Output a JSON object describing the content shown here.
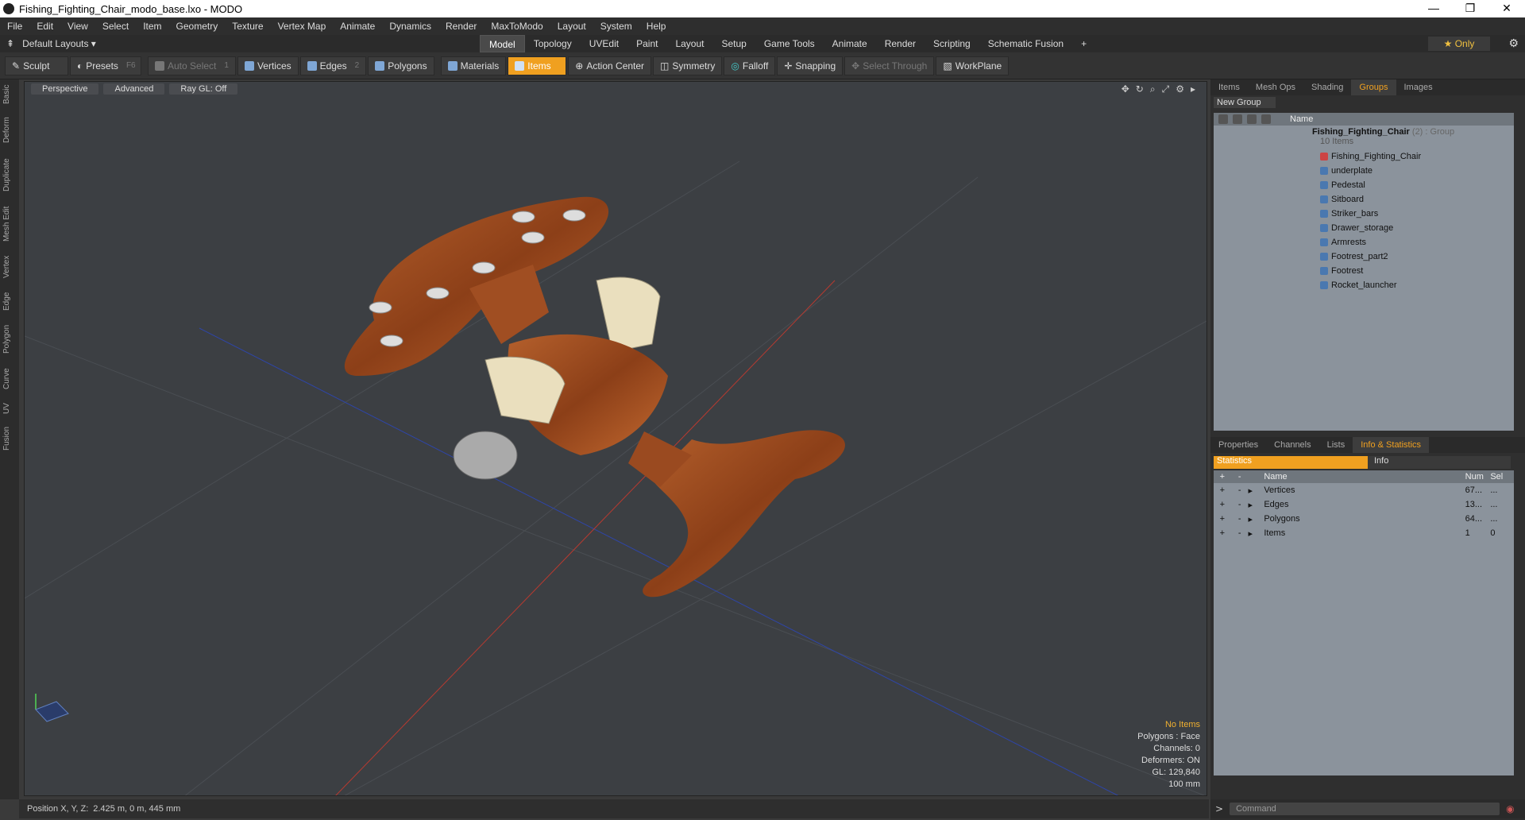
{
  "window": {
    "title": "Fishing_Fighting_Chair_modo_base.lxo - MODO",
    "controls": [
      "—",
      "❐",
      "✕"
    ]
  },
  "menu": [
    "File",
    "Edit",
    "View",
    "Select",
    "Item",
    "Geometry",
    "Texture",
    "Vertex Map",
    "Animate",
    "Dynamics",
    "Render",
    "MaxToModo",
    "Layout",
    "System",
    "Help"
  ],
  "layout": {
    "default": "Default Layouts ▾",
    "tabs": [
      "Model",
      "Topology",
      "UVEdit",
      "Paint",
      "Layout",
      "Setup",
      "Game Tools",
      "Animate",
      "Render",
      "Scripting",
      "Schematic Fusion"
    ],
    "active_tab": "Model",
    "plus": "+",
    "only": "★ Only"
  },
  "toolbar": {
    "sculpt": "Sculpt",
    "presets": "Presets",
    "presets_key": "F6",
    "auto_select": "Auto Select",
    "vertices": "Vertices",
    "vertices_count": "1",
    "edges": "Edges",
    "edges_count": "2",
    "polygons": "Polygons",
    "materials": "Materials",
    "items": "Items",
    "action_center": "Action Center",
    "symmetry": "Symmetry",
    "falloff": "Falloff",
    "snapping": "Snapping",
    "select_through": "Select Through",
    "workplane": "WorkPlane"
  },
  "left_tabs": [
    "Basic",
    "Deform",
    "Duplicate",
    "Mesh Edit",
    "Vertex",
    "Edge",
    "Polygon",
    "Curve",
    "UV",
    "Fusion"
  ],
  "viewport": {
    "view": "Perspective",
    "shading": "Advanced",
    "raygl": "Ray GL: Off",
    "stats": {
      "selection": "No Items",
      "polygons": "Polygons : Face",
      "channels": "Channels: 0",
      "deformers": "Deformers: ON",
      "gl": "GL: 129,840",
      "scale": "100 mm"
    }
  },
  "status": {
    "label": "Position X, Y, Z:",
    "value": "2.425 m, 0 m, 445 mm"
  },
  "items_panel": {
    "tabs": [
      "Items",
      "Mesh Ops",
      "Shading",
      "Groups",
      "Images"
    ],
    "active_tab": "Groups",
    "new_group": "New Group",
    "name_header": "Name",
    "group_name": "Fishing_Fighting_Chair",
    "group_count": "(2)",
    "group_type": ": Group",
    "group_sub": "10 Items",
    "items": [
      "Fishing_Fighting_Chair",
      "underplate",
      "Pedestal",
      "Sitboard",
      "Striker_bars",
      "Drawer_storage",
      "Armrests",
      "Footrest_part2",
      "Footrest",
      "Rocket_launcher"
    ]
  },
  "stats_panel": {
    "tabs": [
      "Properties",
      "Channels",
      "Lists",
      "Info & Statistics"
    ],
    "active_tab": "Info & Statistics",
    "sub_tabs": [
      "Statistics",
      "Info"
    ],
    "headers": {
      "name": "Name",
      "num": "Num",
      "sel": "Sel"
    },
    "rows": [
      {
        "name": "Vertices",
        "num": "67...",
        "sel": "..."
      },
      {
        "name": "Edges",
        "num": "13...",
        "sel": "..."
      },
      {
        "name": "Polygons",
        "num": "64...",
        "sel": "..."
      },
      {
        "name": "Items",
        "num": "1",
        "sel": "0"
      }
    ]
  },
  "command": {
    "placeholder": "Command",
    "prompt": ">"
  }
}
